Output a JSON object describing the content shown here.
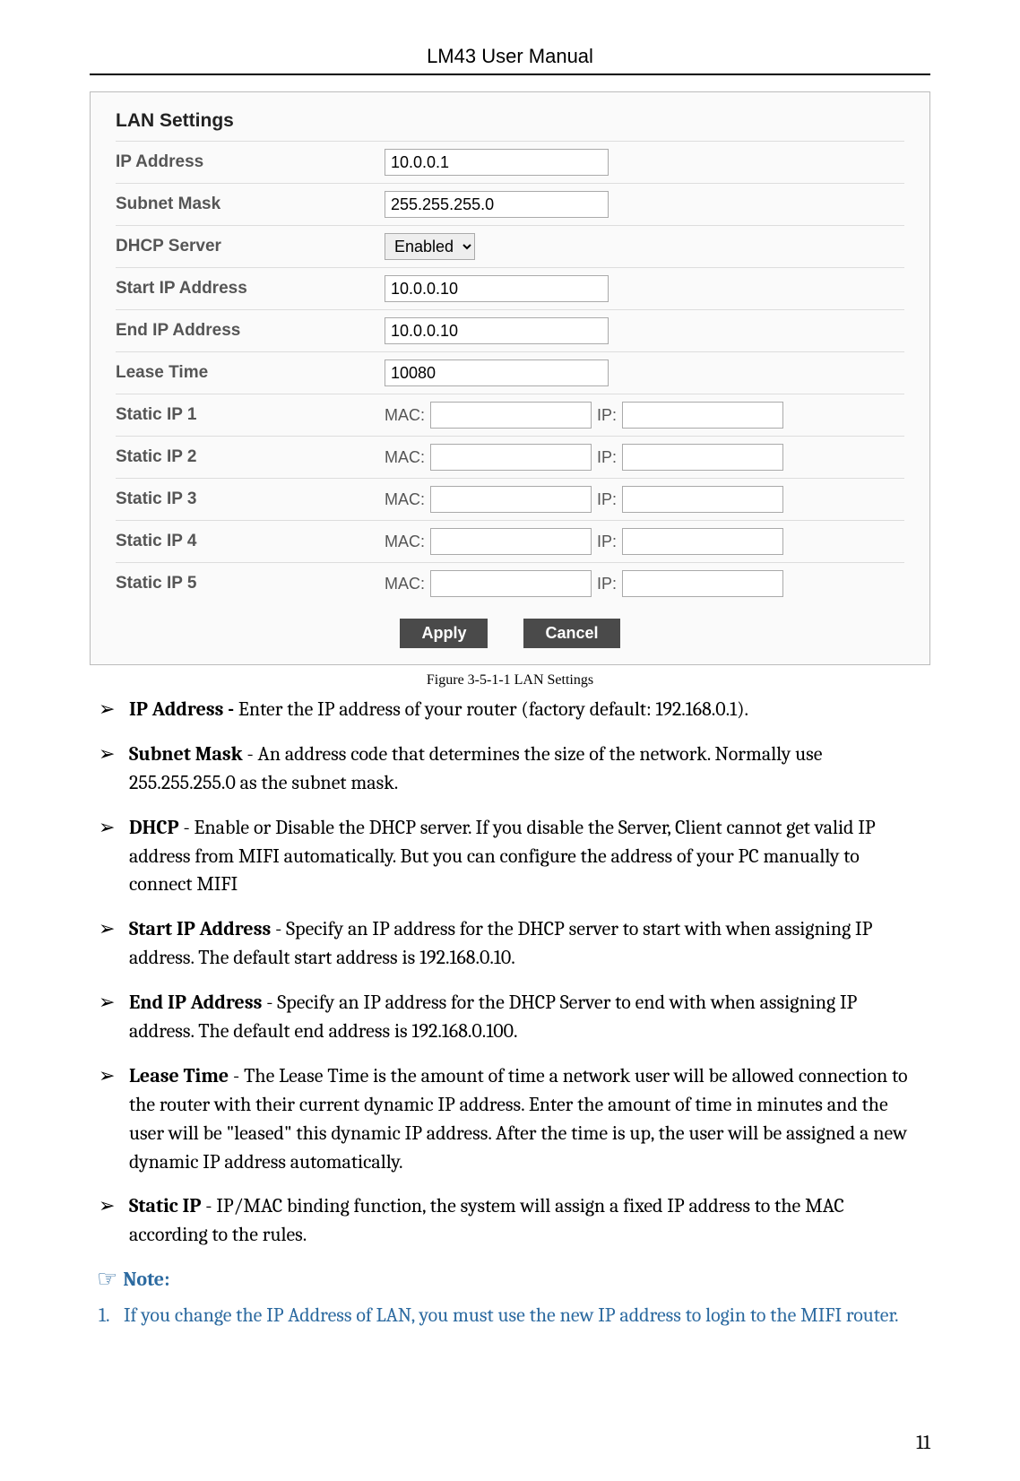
{
  "header": {
    "title": "LM43 User Manual"
  },
  "panel": {
    "title": "LAN Settings",
    "rows": {
      "ip_address": {
        "label": "IP Address",
        "value": "10.0.0.1"
      },
      "subnet_mask": {
        "label": "Subnet Mask",
        "value": "255.255.255.0"
      },
      "dhcp_server": {
        "label": "DHCP Server",
        "value": "Enabled"
      },
      "start_ip": {
        "label": "Start IP Address",
        "value": "10.0.0.10"
      },
      "end_ip": {
        "label": "End IP Address",
        "value": "10.0.0.10"
      },
      "lease_time": {
        "label": "Lease Time",
        "value": "10080"
      },
      "static1": {
        "label": "Static IP 1",
        "mac_label": "MAC:",
        "ip_label": "IP:",
        "mac": "",
        "ip": ""
      },
      "static2": {
        "label": "Static IP 2",
        "mac_label": "MAC:",
        "ip_label": "IP:",
        "mac": "",
        "ip": ""
      },
      "static3": {
        "label": "Static IP 3",
        "mac_label": "MAC:",
        "ip_label": "IP:",
        "mac": "",
        "ip": ""
      },
      "static4": {
        "label": "Static IP 4",
        "mac_label": "MAC:",
        "ip_label": "IP:",
        "mac": "",
        "ip": ""
      },
      "static5": {
        "label": "Static IP 5",
        "mac_label": "MAC:",
        "ip_label": "IP:",
        "mac": "",
        "ip": ""
      }
    },
    "buttons": {
      "apply": "Apply",
      "cancel": "Cancel"
    }
  },
  "figure_caption": "Figure 3-5-1-1 LAN Settings",
  "bullets": [
    {
      "term": "IP Address -",
      "text": " Enter the IP address of your router (factory default: 192.168.0.1)."
    },
    {
      "term": "Subnet Mask",
      "text": " - An address code that determines the size of the network. Normally use 255.255.255.0 as the subnet mask."
    },
    {
      "term": "DHCP",
      "text": " - Enable or Disable the DHCP server. If you disable the Server, Client cannot get valid IP address from MIFI automatically. But you can configure the address of your PC manually to connect MIFI"
    },
    {
      "term": "Start IP Address",
      "text": " - Specify an IP address for the DHCP server to start with when assigning IP address. The default start address is 192.168.0.10."
    },
    {
      "term": "End IP Address",
      "text": " - Specify an IP address for the DHCP Server to end with when assigning IP address. The default end address is 192.168.0.100."
    },
    {
      "term": "Lease Time",
      "text": " - The Lease Time is the amount of time a network user will be allowed connection to the router with their current dynamic IP address. Enter the amount of time in minutes and the user will be \"leased\" this dynamic IP address. After the time is up, the user will be assigned a new dynamic IP address automatically."
    },
    {
      "term": "Static IP",
      "text": " - IP/MAC binding function, the system will assign a fixed IP address to the MAC according to the rules."
    }
  ],
  "note": {
    "icon": "☞",
    "label": "Note:",
    "items": [
      {
        "num": "1.",
        "text": "If you change the IP Address of LAN, you must use the new IP address to login to the MIFI router."
      }
    ]
  },
  "page_number": "11"
}
